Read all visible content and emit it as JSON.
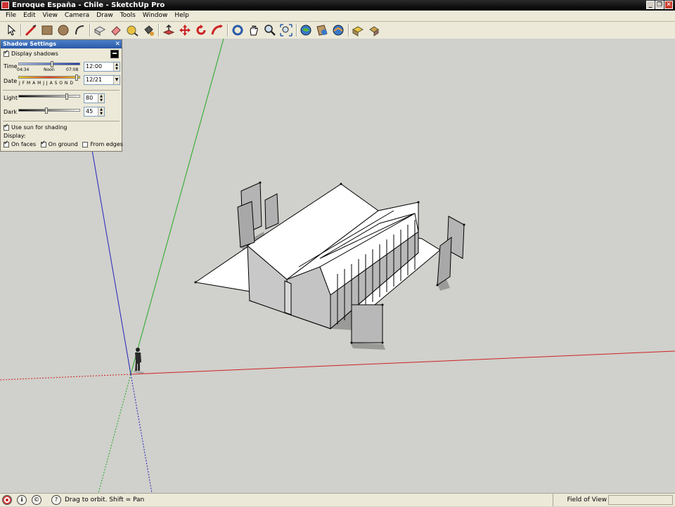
{
  "window": {
    "title": "Enroque España - Chile - SketchUp Pro",
    "min_label": "_",
    "restore_label": "❐",
    "close_label": "✕"
  },
  "menu": [
    "File",
    "Edit",
    "View",
    "Camera",
    "Draw",
    "Tools",
    "Window",
    "Help"
  ],
  "toolbar": {
    "tools": [
      "select",
      "line",
      "rectangle",
      "circle",
      "arc",
      "make-component",
      "eraser",
      "tape-measure",
      "paint-bucket",
      "push-pull",
      "move",
      "rotate",
      "follow-me",
      "orbit",
      "pan",
      "zoom",
      "zoom-extents",
      "get-models",
      "share-model",
      "share-component",
      "get-photo-textures",
      "preview-google-earth"
    ]
  },
  "shadow_panel": {
    "title": "Shadow Settings",
    "display_shadows_label": "Display shadows",
    "display_shadows": true,
    "time_label": "Time",
    "time_start": "04:34",
    "time_noon": "Noon",
    "time_end": "07:08",
    "time_value": "12:00",
    "time_fraction": 0.55,
    "date_label": "Date",
    "months": "J F M A M J J A S O N D",
    "date_value": "12/21",
    "date_fraction": 0.97,
    "light_label": "Light",
    "light_value": "80",
    "light_fraction": 0.8,
    "dark_label": "Dark",
    "dark_value": "45",
    "dark_fraction": 0.45,
    "use_sun_label": "Use sun for shading",
    "use_sun": true,
    "display_label": "Display:",
    "on_faces_label": "On faces",
    "on_faces": true,
    "on_ground_label": "On ground",
    "on_ground": true,
    "from_edges_label": "From edges",
    "from_edges": false
  },
  "status": {
    "message": "Drag to orbit.  Shift = Pan",
    "field_label": "Field of View",
    "field_value": ""
  },
  "colors": {
    "axis_red": "#cc2222",
    "axis_green": "#22aa22",
    "axis_blue": "#2222bb",
    "face": "#c8c8c8",
    "roof": "#ffffff",
    "shadow": "#9a9a98"
  }
}
